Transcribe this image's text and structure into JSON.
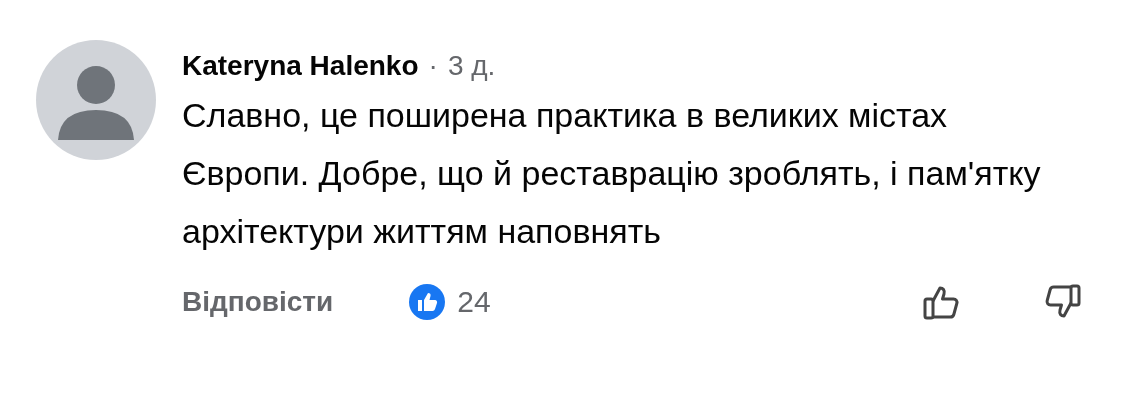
{
  "comment": {
    "author": "Kateryna Halenko",
    "separator": "·",
    "time": "3 д.",
    "text": "Славно, це поширена практика в великих містах Європи. Добре, що й реставрацію зроблять, і пам'ятку архітектури життям наповнять",
    "reply_label": "Відповісти",
    "reaction_count": "24"
  }
}
